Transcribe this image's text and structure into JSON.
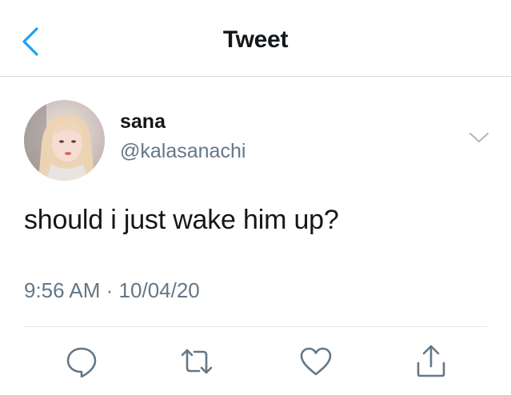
{
  "header": {
    "title": "Tweet",
    "back_icon": "chevron-left-icon"
  },
  "tweet": {
    "author_name": "sana",
    "author_handle": "@kalasanachi",
    "text": "should i just wake him up?",
    "time": "9:56 AM",
    "separator": "·",
    "date": "10/04/20"
  },
  "actions": [
    {
      "name": "reply",
      "icon": "speech-bubble-icon"
    },
    {
      "name": "retweet",
      "icon": "retweet-icon"
    },
    {
      "name": "like",
      "icon": "heart-icon"
    },
    {
      "name": "share",
      "icon": "share-icon"
    }
  ],
  "colors": {
    "accent": "#1da1f2",
    "text_primary": "#14171a",
    "text_secondary": "#657786",
    "divider": "#e1e8ed",
    "icon_gray": "#657786"
  }
}
